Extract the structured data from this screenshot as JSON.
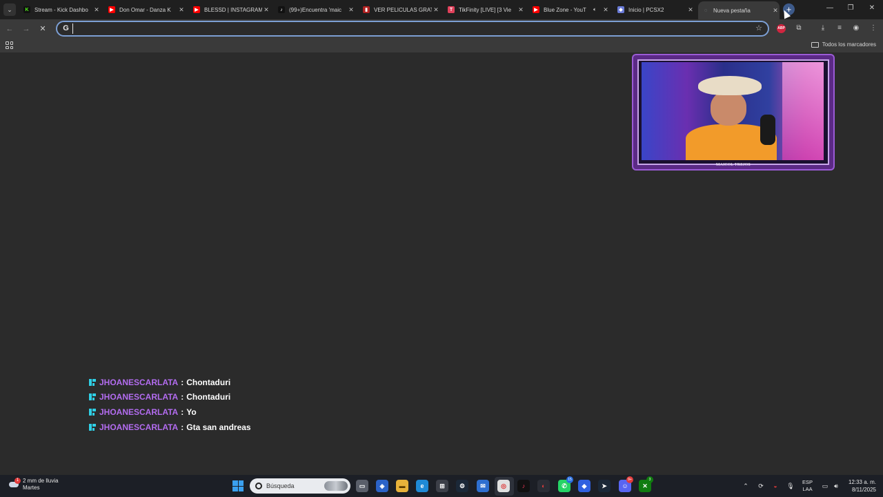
{
  "browser": {
    "tabs": [
      {
        "title": "Stream - Kick Dashbo",
        "icon": "kick-icon",
        "color": "#53fc18"
      },
      {
        "title": "Don Omar - Danza K",
        "icon": "youtube-icon",
        "color": "#ff0000"
      },
      {
        "title": "BLESSD | INSTAGRAM",
        "icon": "youtube-icon",
        "color": "#ff0000"
      },
      {
        "title": "(99+)Encuentra 'maic",
        "icon": "tiktok-icon",
        "color": "#111111"
      },
      {
        "title": "VER PELICULAS GRAT",
        "icon": "movie-site-icon",
        "color": "#b22222"
      },
      {
        "title": "TikFinity [LIVE] [3 Vie",
        "icon": "tikfinity-icon",
        "color": "#e0405a"
      },
      {
        "title": "Blue Zone - YouT",
        "icon": "youtube-icon",
        "color": "#ff0000",
        "audio": true
      },
      {
        "title": "Inicio | PCSX2",
        "icon": "pcsx2-icon",
        "color": "#6a7bd8"
      },
      {
        "title": "Nueva pestaña",
        "icon": "new-tab-icon",
        "color": "#9aa0a6",
        "active": true
      }
    ],
    "omnibox": {
      "value": "",
      "placeholder": ""
    },
    "bookmarks": {
      "all_label": "Todos los marcadores"
    }
  },
  "stream_overlay": {
    "cam_caption": "MAICOL TREJOS",
    "chat": [
      {
        "user": "JHOANESCARLATA",
        "sep": ":",
        "message": "Chontaduri"
      },
      {
        "user": "JHOANESCARLATA",
        "sep": ":",
        "message": "Chontaduri"
      },
      {
        "user": "JHOANESCARLATA",
        "sep": ":",
        "message": "Yo"
      },
      {
        "user": "JHOANESCARLATA",
        "sep": ":",
        "message": "Gta san andreas"
      }
    ]
  },
  "taskbar": {
    "weather": {
      "line1": "2 mm de lluvia",
      "line2": "Martes",
      "alert_count": "1"
    },
    "search_label": "Búsqueda",
    "language": {
      "line1": "ESP",
      "line2": "LAA"
    },
    "clock": {
      "time": "12:33 a. m.",
      "date": "8/11/2025"
    },
    "badges": {
      "whatsapp": "15",
      "discord": "9+",
      "xbox": "3"
    }
  }
}
